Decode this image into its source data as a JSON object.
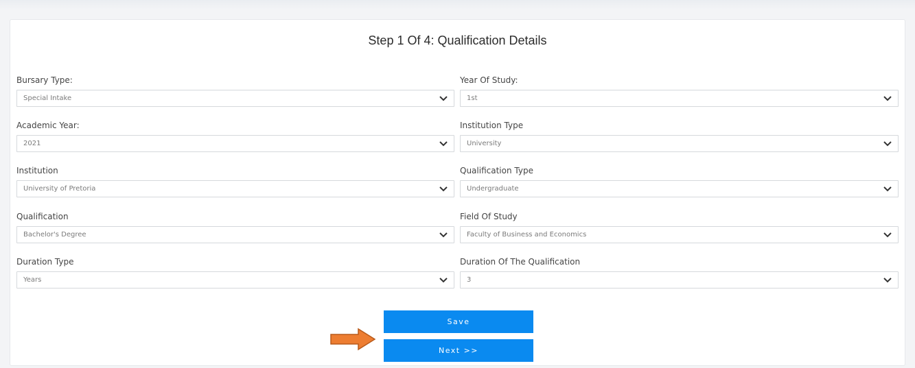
{
  "form": {
    "title": "Step 1 Of 4: Qualification Details",
    "fields": [
      {
        "label": "Bursary Type:",
        "value": "Special Intake"
      },
      {
        "label": "Year Of Study:",
        "value": "1st"
      },
      {
        "label": "Academic Year:",
        "value": "2021"
      },
      {
        "label": "Institution Type",
        "value": "University"
      },
      {
        "label": "Institution",
        "value": "University of Pretoria"
      },
      {
        "label": "Qualification Type",
        "value": "Undergraduate"
      },
      {
        "label": "Qualification",
        "value": "Bachelor's Degree"
      },
      {
        "label": "Field Of Study",
        "value": "Faculty of Business and Economics"
      },
      {
        "label": "Duration Type",
        "value": "Years"
      },
      {
        "label": "Duration Of The Qualification",
        "value": "3"
      }
    ],
    "save_label": "Save",
    "next_label": "Next >>"
  },
  "colors": {
    "button": "#0a8af0",
    "arrow": "#ed7d31"
  },
  "icons": {
    "dropdown": "chevron-down-icon",
    "pointer": "right-arrow-icon"
  }
}
